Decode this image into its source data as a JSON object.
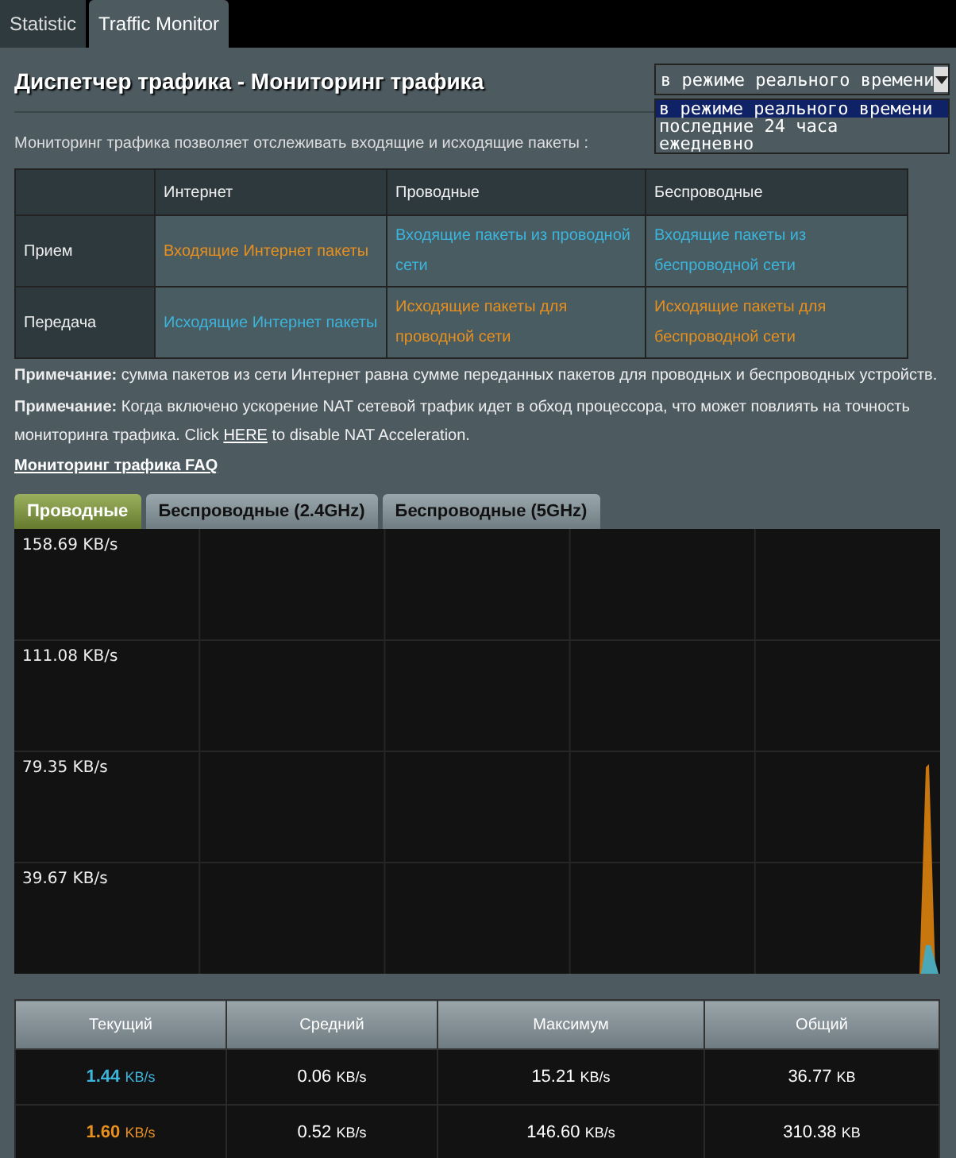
{
  "top_tabs": [
    {
      "label": "Statistic",
      "selected": false
    },
    {
      "label": "Traffic Monitor",
      "selected": true
    }
  ],
  "title": "Диспетчер трафика - Мониторинг трафика",
  "period_dropdown": {
    "value": "в режиме реального времени",
    "options": [
      {
        "label": "в режиме реального времени",
        "selected": true
      },
      {
        "label": "последние 24 часа",
        "selected": false
      },
      {
        "label": "ежедневно",
        "selected": false
      }
    ]
  },
  "description": "Мониторинг трафика позволяет отслеживать входящие и исходящие пакеты :",
  "legend_table": {
    "columns": [
      "Интернет",
      "Проводные",
      "Беспроводные"
    ],
    "rows": [
      {
        "label": "Прием",
        "cells": [
          {
            "text": "Входящие Интернет пакеты",
            "color": "#e8901e"
          },
          {
            "text": "Входящие пакеты из проводной сети",
            "color": "#3cb4dc"
          },
          {
            "text": "Входящие пакеты из беспроводной сети",
            "color": "#3cb4dc"
          }
        ]
      },
      {
        "label": "Передача",
        "cells": [
          {
            "text": "Исходящие Интернет пакеты",
            "color": "#3cb4dc"
          },
          {
            "text": "Исходящие пакеты для проводной сети",
            "color": "#e8901e"
          },
          {
            "text": "Исходящие пакеты для беспроводной сети",
            "color": "#e8901e"
          }
        ]
      }
    ]
  },
  "notes": [
    "**Примечание:** сумма пакетов из сети Интернет равна сумме переданных пакетов для проводных и беспроводных устройств.",
    "**Примечание:** Когда включено ускорение NAT сетевой трафик идет в обход процессора, что может повлиять на точность мониторинга трафика. Click "
  ],
  "here_link": "HERE",
  "note_tail": " to disable NAT Acceleration.",
  "faq_link": "Мониторинг трафика FAQ",
  "graph_tabs": [
    {
      "label": "Проводные",
      "selected": true
    },
    {
      "label": "Беспроводные (2.4GHz)",
      "selected": false
    },
    {
      "label": "Беспроводные (5GHz)",
      "selected": false
    }
  ],
  "graph_labels": [
    "158.69 KB/s",
    "111.08 KB/s",
    "79.35 KB/s",
    "39.67 KB/s"
  ],
  "stats": {
    "columns": [
      "Текущий",
      "Средний",
      "Максимум",
      "Общий"
    ],
    "rows": [
      {
        "color": "#3cb4dc",
        "cells": [
          {
            "value": "1.44",
            "unit": "KB/s"
          },
          {
            "value": "0.06",
            "unit": "KB/s"
          },
          {
            "value": "15.21",
            "unit": "KB/s"
          },
          {
            "value": "36.77",
            "unit": "KB"
          }
        ]
      },
      {
        "color": "#e8901e",
        "cells": [
          {
            "value": "1.60",
            "unit": "KB/s"
          },
          {
            "value": "0.52",
            "unit": "KB/s"
          },
          {
            "value": "146.60",
            "unit": "KB/s"
          },
          {
            "value": "310.38",
            "unit": "KB"
          }
        ]
      }
    ]
  }
}
